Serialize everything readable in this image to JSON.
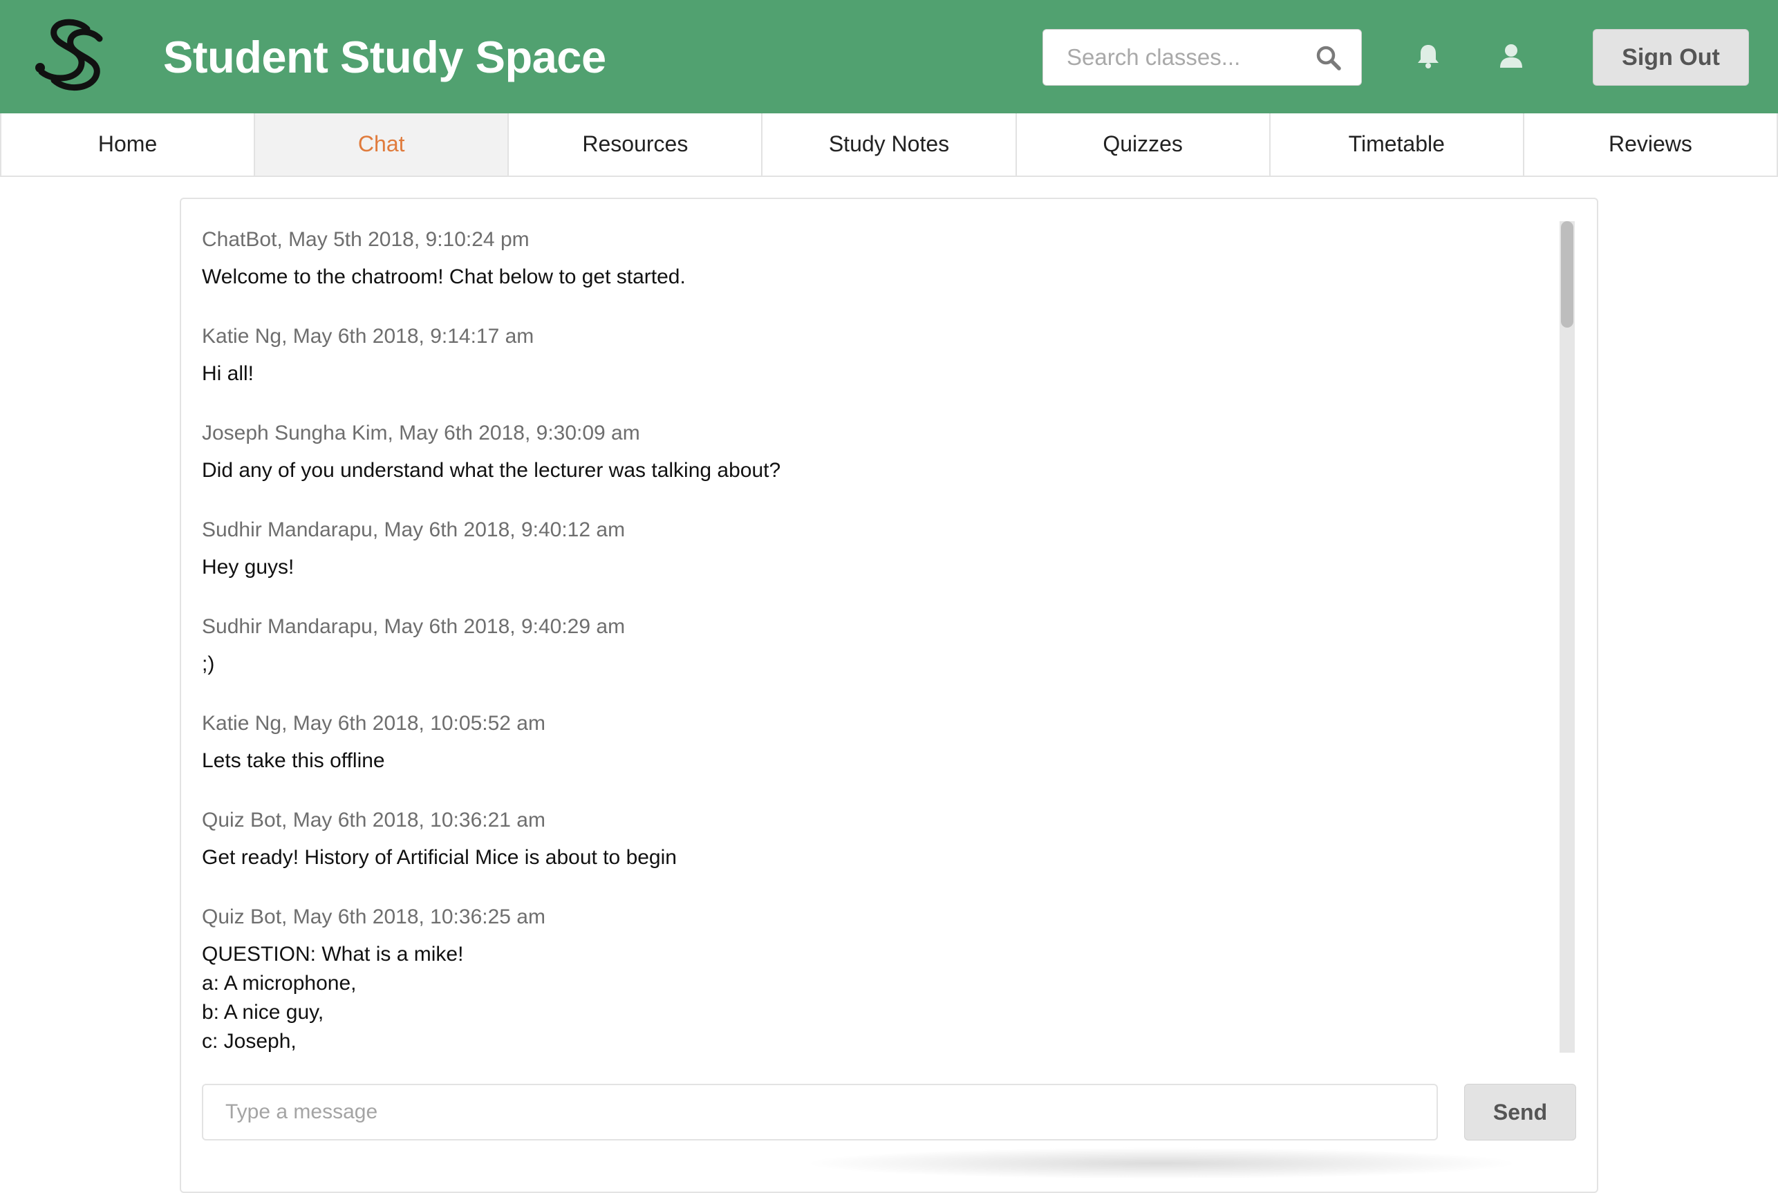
{
  "header": {
    "logo": "SS",
    "title": "Student Study Space",
    "search_placeholder": "Search classes...",
    "search_icon": "search-icon",
    "notifications_icon": "bell-icon",
    "profile_icon": "user-icon",
    "sign_out_label": "Sign Out",
    "colors": {
      "brand": "#51a170",
      "active_tab_text": "#e07b3c"
    }
  },
  "nav": {
    "tabs": [
      {
        "label": "Home",
        "active": false
      },
      {
        "label": "Chat",
        "active": true
      },
      {
        "label": "Resources",
        "active": false
      },
      {
        "label": "Study Notes",
        "active": false
      },
      {
        "label": "Quizzes",
        "active": false
      },
      {
        "label": "Timetable",
        "active": false
      },
      {
        "label": "Reviews",
        "active": false
      }
    ]
  },
  "chat": {
    "messages": [
      {
        "meta": "ChatBot, May 5th 2018, 9:10:24 pm",
        "text": "Welcome to the chatroom! Chat below to get started."
      },
      {
        "meta": "Katie Ng, May 6th 2018, 9:14:17 am",
        "text": "Hi all!"
      },
      {
        "meta": "Joseph Sungha Kim, May 6th 2018, 9:30:09 am",
        "text": "Did any of you understand what the lecturer was talking about?"
      },
      {
        "meta": "Sudhir Mandarapu, May 6th 2018, 9:40:12 am",
        "text": "Hey guys!"
      },
      {
        "meta": "Sudhir Mandarapu, May 6th 2018, 9:40:29 am",
        "text": ";)"
      },
      {
        "meta": "Katie Ng, May 6th 2018, 10:05:52 am",
        "text": "Lets take this offline"
      },
      {
        "meta": "Quiz Bot, May 6th 2018, 10:36:21 am",
        "text": "Get ready! History of Artificial Mice is about to begin"
      },
      {
        "meta": "Quiz Bot, May 6th 2018, 10:36:25 am",
        "text": "QUESTION: What is a mike!\na: A microphone,\nb: A nice guy,\nc: Joseph,\nd: The man dis behind Monash University"
      }
    ],
    "composer_placeholder": "Type a message",
    "send_label": "Send"
  }
}
